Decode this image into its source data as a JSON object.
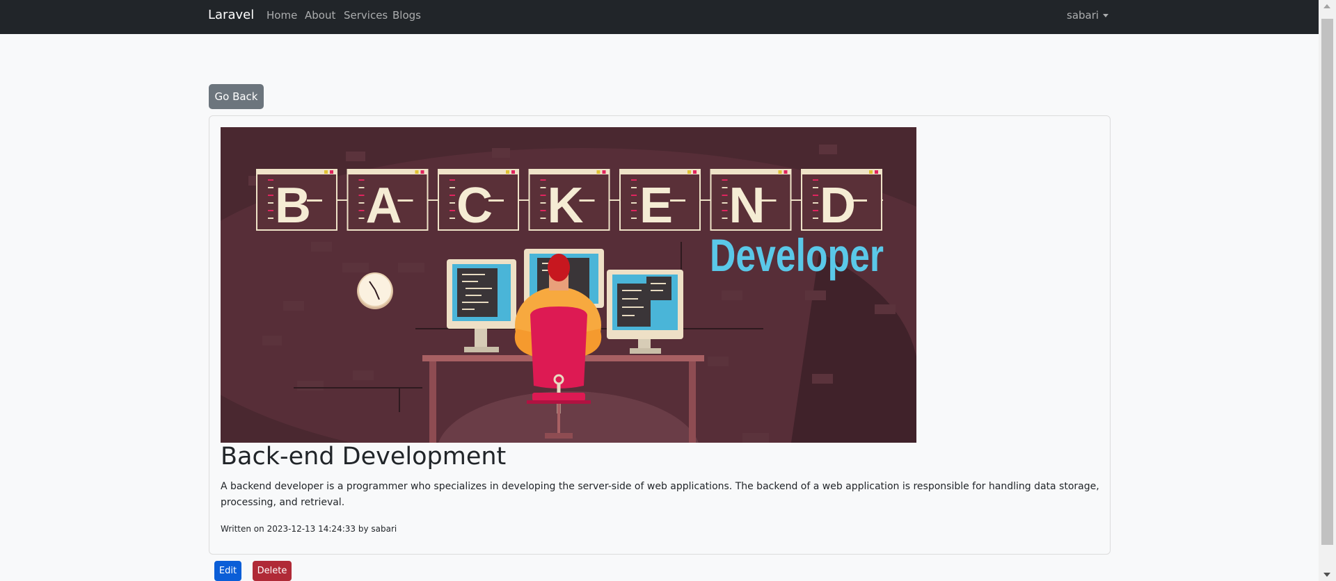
{
  "navbar": {
    "brand": "Laravel",
    "links": [
      {
        "label": "Home"
      },
      {
        "label": "About"
      },
      {
        "label": "Services"
      },
      {
        "label": "Blogs"
      }
    ],
    "user": "sabari"
  },
  "actions": {
    "go_back": "Go Back",
    "edit": "Edit",
    "delete": "Delete"
  },
  "post": {
    "title": "Back-end Development",
    "body": "A backend developer is a programmer who specializes in developing the server-side of web applications. The backend of a web application is responsible for handling data storage, processing, and retrieval.",
    "meta": "Written on 2023-12-13 14:24:33 by sabari",
    "image": {
      "letters": [
        "B",
        "A",
        "C",
        "K",
        "E",
        "N",
        "D"
      ],
      "caption": "Developer"
    }
  },
  "colors": {
    "navbar_bg": "#212529",
    "page_bg": "#f8f9fa",
    "secondary": "#6c757d",
    "primary": "#0b5ed7",
    "danger": "#b02a37",
    "hero_bg": "#4a2830",
    "hero_accent": "#5ac8e8"
  }
}
